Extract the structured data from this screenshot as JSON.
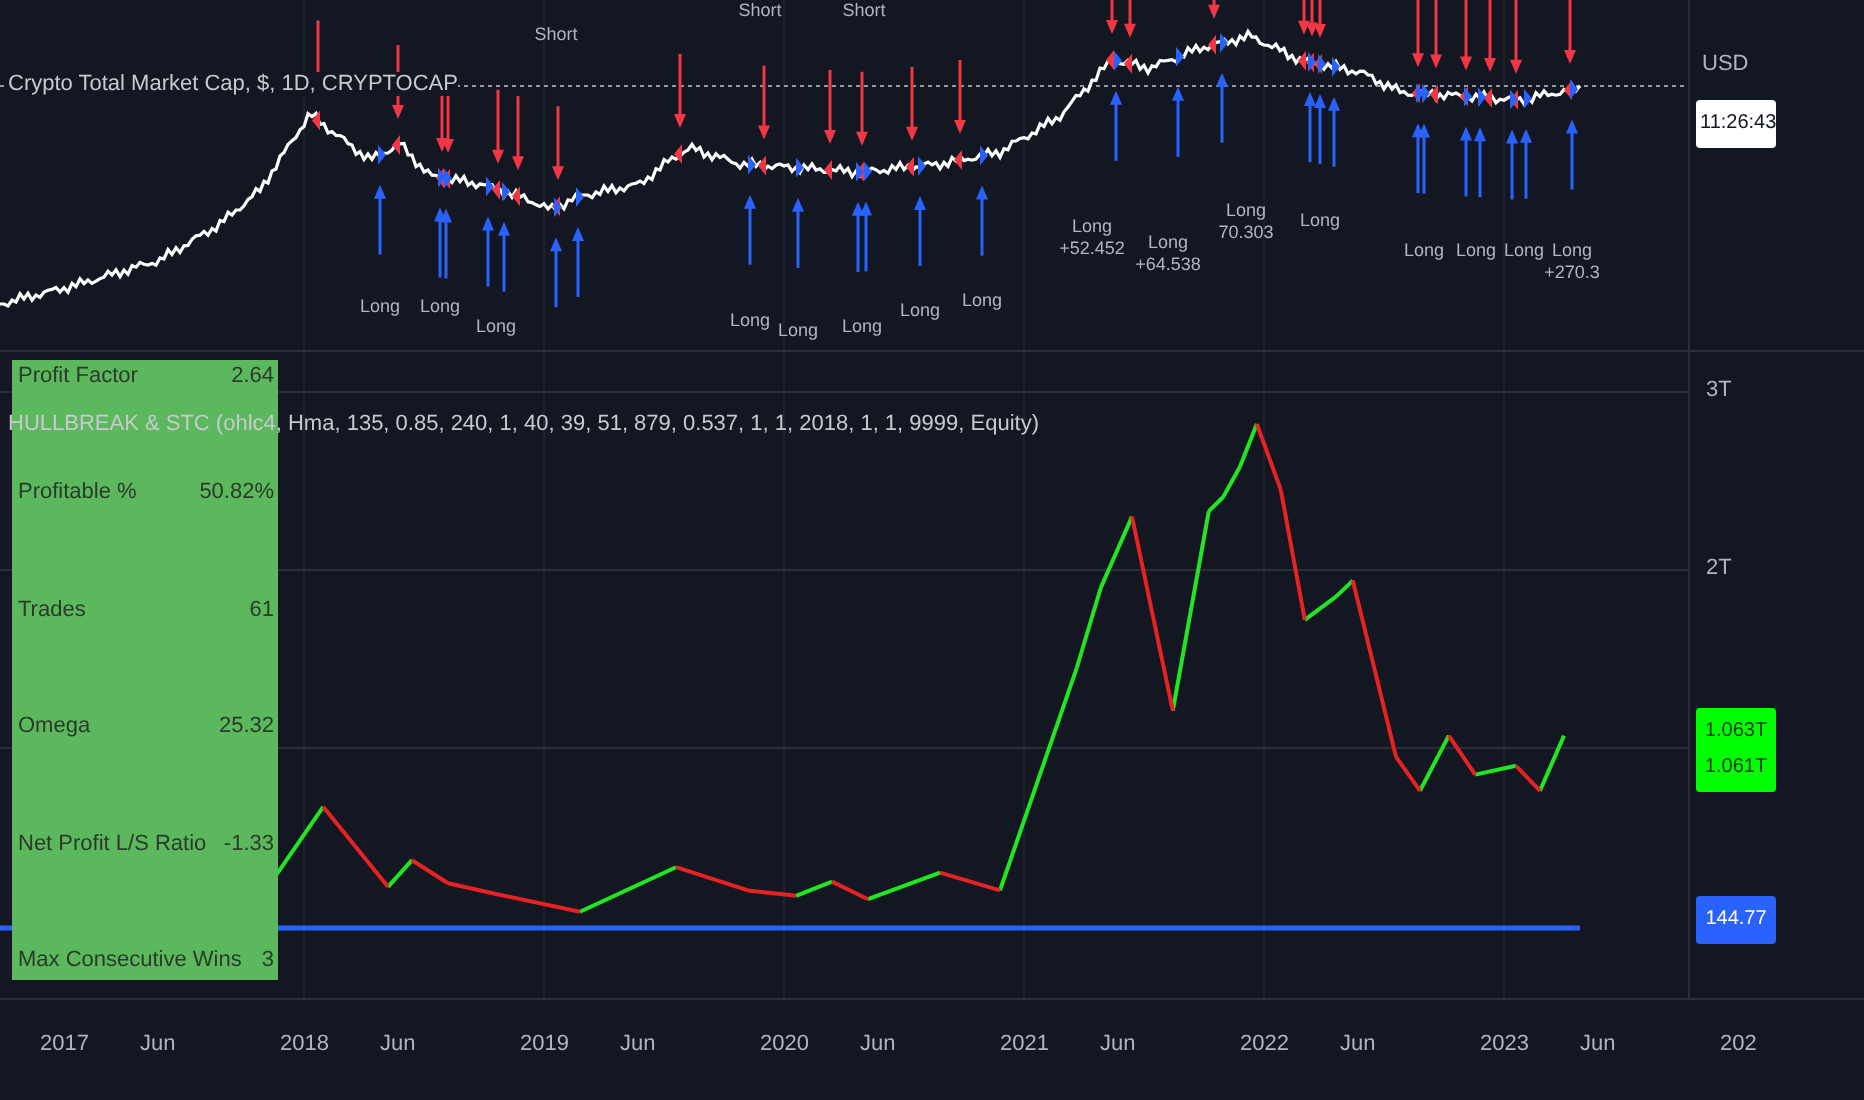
{
  "price_pane": {
    "legend": "Crypto Total Market Cap, $, 1D, CRYPTOCAP",
    "currency": "USD",
    "countdown": "11:26:43",
    "short_labels": [
      "Short",
      "Short",
      "Short"
    ],
    "long_labels": [
      {
        "lines": [
          "Long"
        ]
      },
      {
        "lines": [
          "Long"
        ]
      },
      {
        "lines": [
          "Long"
        ]
      },
      {
        "lines": [
          "Long"
        ]
      },
      {
        "lines": [
          "Long"
        ]
      },
      {
        "lines": [
          "Long"
        ]
      },
      {
        "lines": [
          "Long"
        ]
      },
      {
        "lines": [
          "Long"
        ]
      },
      {
        "lines": [
          "Long",
          "+52.452"
        ]
      },
      {
        "lines": [
          "Long",
          "+64.538"
        ]
      },
      {
        "lines": [
          "Long",
          "70.303"
        ]
      },
      {
        "lines": [
          "Long"
        ]
      },
      {
        "lines": [
          "Long"
        ]
      },
      {
        "lines": [
          "Long"
        ]
      },
      {
        "lines": [
          "Long"
        ]
      },
      {
        "lines": [
          "Long",
          "+270.3"
        ]
      }
    ]
  },
  "strategy_pane": {
    "legend": "HULLBREAK & STC (ohlc4, Hma, 135, 0.85, 240, 1, 40, 39, 51, 879, 0.537, 1, 1, 2018, 1, 1, 9999, Equity)",
    "stats": [
      {
        "label": "Profit Factor",
        "value": "2.64"
      },
      {
        "label": "Profitable %",
        "value": "50.82%"
      },
      {
        "label": "Trades",
        "value": "61"
      },
      {
        "label": "Omega",
        "value": "25.32"
      },
      {
        "label": "Net Profit L/S Ratio",
        "value": "-1.33"
      },
      {
        "label": "Max Consecutive Wins",
        "value": "3"
      }
    ],
    "price_labels": [
      {
        "kind": "equity",
        "lines": [
          "1.063T",
          "1.061T"
        ],
        "color": "#00ff00"
      },
      {
        "kind": "baseline",
        "lines": [
          "144.77"
        ],
        "color": "#2962ff"
      }
    ],
    "scale_ticks": [
      "3T",
      "2T"
    ]
  },
  "time_axis": [
    "2017",
    "Jun",
    "2018",
    "Jun",
    "2019",
    "Jun",
    "2020",
    "Jun",
    "2021",
    "Jun",
    "2022",
    "Jun",
    "2023",
    "Jun",
    "202"
  ]
}
